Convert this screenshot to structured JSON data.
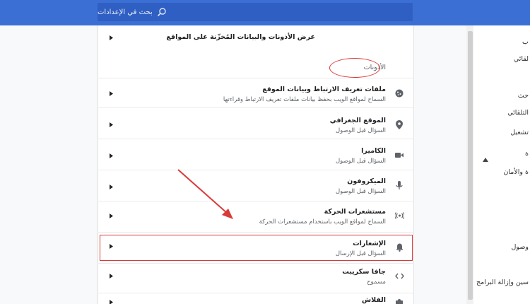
{
  "search": {
    "placeholder": "بحث في الإعدادات"
  },
  "rows": {
    "site_data": {
      "title": "عرض الأذونات والبيانات المُخزّنة على المواقع"
    },
    "section_heading": "الأذونات",
    "cookies": {
      "title": "ملفات تعريف الارتباط وبيانات الموقع",
      "sub": "السماح لمواقع الويب بحفظ بيانات ملفات تعريف الارتباط وقراءتها"
    },
    "location": {
      "title": "الموقع الجغرافي",
      "sub": "السؤال قبل الوصول"
    },
    "camera": {
      "title": "الكاميرا",
      "sub": "السؤال قبل الوصول"
    },
    "microphone": {
      "title": "الميكروفون",
      "sub": "السؤال قبل الوصول"
    },
    "motion": {
      "title": "مستشعرات الحركة",
      "sub": "السماح لمواقع الويب باستخدام مستشعرات الحركة"
    },
    "notifications": {
      "title": "الإشعارات",
      "sub": "السؤال قبل الإرسال"
    },
    "javascript": {
      "title": "جافا سكريبت",
      "sub": "مسموح"
    },
    "flash": {
      "title": "الفلاش"
    }
  },
  "sidebar": {
    "item1": "ب",
    "item2": "لقائي",
    "item3": "حث",
    "item4": "التلقائي",
    "item5": "تشغيل",
    "item6": "ة",
    "item7": "ة والأمان",
    "item8": "وصول",
    "item9": "سين وإزالة البرامج"
  },
  "colors": {
    "topbar": "#3b6fd4",
    "search_bg": "#2f5fc2",
    "annotation": "#d93a3a"
  }
}
